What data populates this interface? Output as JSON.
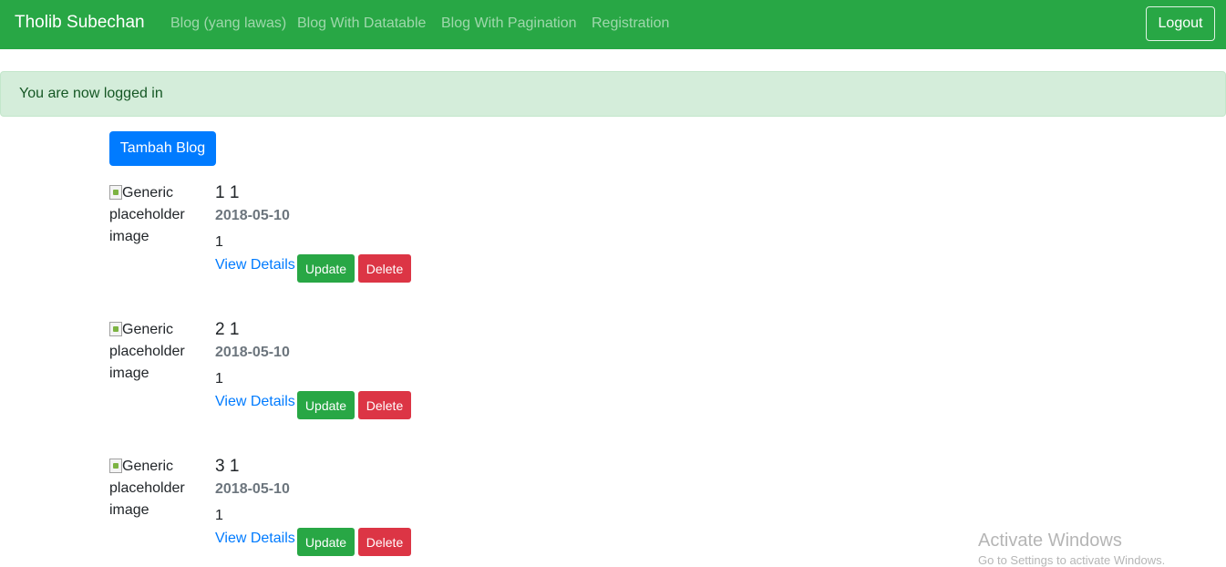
{
  "navbar": {
    "brand": "Tholib Subechan",
    "links": [
      "Blog (yang lawas)",
      "Blog With Datatable",
      "Blog With Pagination",
      "Registration"
    ],
    "logout_label": "Logout",
    "color": "#28a745"
  },
  "alert": {
    "message": "You are now logged in"
  },
  "actions": {
    "add_label": "Tambah Blog"
  },
  "blogs": [
    {
      "image_alt": "Generic placeholder image",
      "title": "1 1",
      "date": "2018-05-10",
      "body": "1",
      "view_label": "View Details",
      "update_label": "Update",
      "delete_label": "Delete"
    },
    {
      "image_alt": "Generic placeholder image",
      "title": "2 1",
      "date": "2018-05-10",
      "body": "1",
      "view_label": "View Details",
      "update_label": "Update",
      "delete_label": "Delete"
    },
    {
      "image_alt": "Generic placeholder image",
      "title": "3 1",
      "date": "2018-05-10",
      "body": "1",
      "view_label": "View Details",
      "update_label": "Update",
      "delete_label": "Delete"
    }
  ],
  "watermark": {
    "title": "Activate Windows",
    "subtitle": "Go to Settings to activate Windows."
  }
}
